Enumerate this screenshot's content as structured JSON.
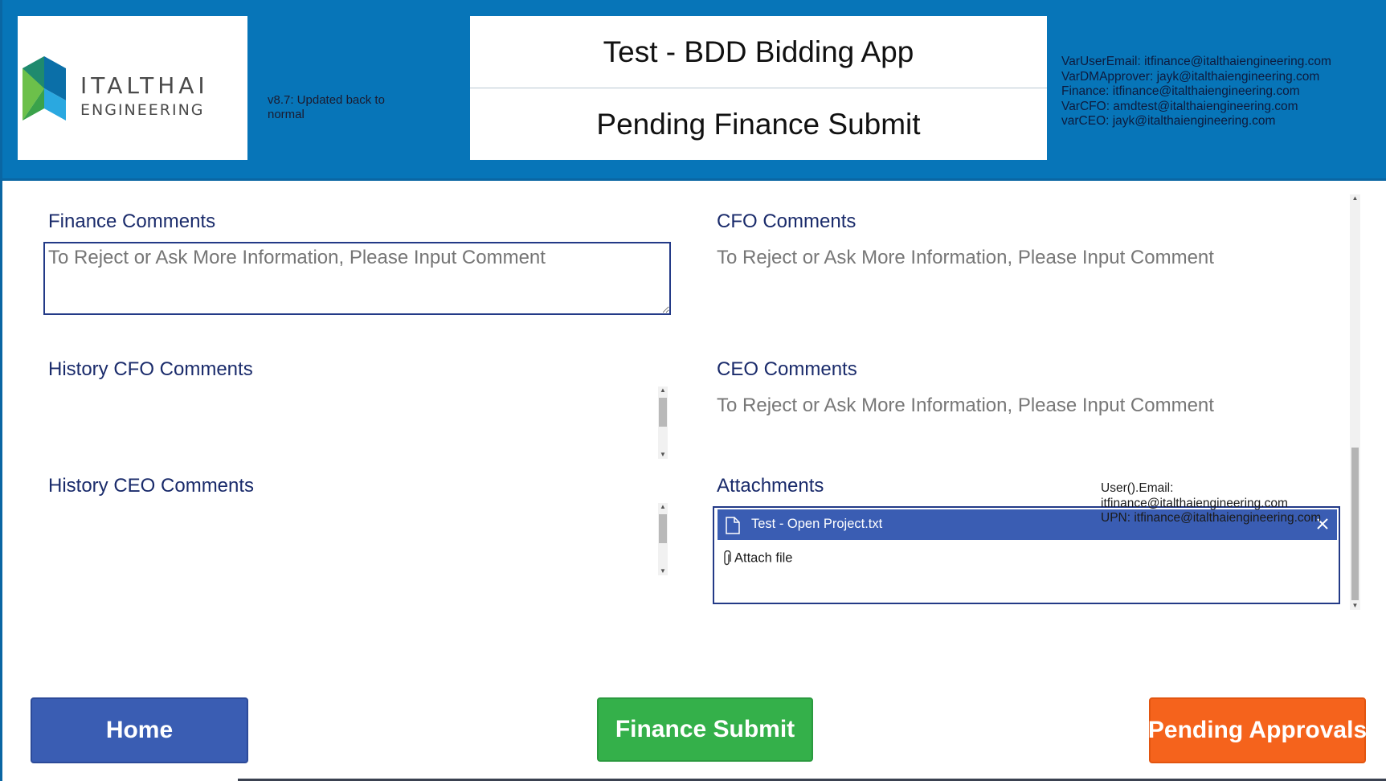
{
  "header": {
    "logo": {
      "word1": "ITALTHAI",
      "word2": "ENGINEERING"
    },
    "version_note": "v8.7: Updated back to normal",
    "app_title": "Test - BDD Bidding App",
    "screen_title": "Pending Finance Submit",
    "vars": [
      "VarUserEmail: itfinance@italthaiengineering.com",
      "VarDMApprover: jayk@italthaiengineering.com",
      "Finance: itfinance@italthaiengineering.com",
      "VarCFO: amdtest@italthaiengineering.com",
      "varCEO: jayk@italthaiengineering.com"
    ]
  },
  "form": {
    "finance_comments": {
      "label": "Finance Comments",
      "placeholder": "To Reject or Ask More Information, Please Input Comment",
      "value": ""
    },
    "cfo_comments": {
      "label": "CFO Comments",
      "placeholder": "To Reject or Ask More Information, Please Input Comment"
    },
    "history_cfo": {
      "label": "History CFO Comments"
    },
    "ceo_comments": {
      "label": "CEO Comments",
      "placeholder": "To Reject or Ask More Information, Please Input Comment"
    },
    "history_ceo": {
      "label": "History CEO Comments"
    },
    "attachments": {
      "label": "Attachments",
      "files": [
        {
          "name": "Test - Open Project.txt"
        }
      ],
      "attach_label": "Attach file"
    },
    "debug": {
      "line1": "User().Email:",
      "line2": "itfinance@italthaiengineering.com",
      "line3": "UPN: itfinance@italthaiengineering.com"
    }
  },
  "buttons": {
    "home": "Home",
    "finance_submit": "Finance Submit",
    "pending_approvals": "Pending Approvals"
  },
  "colors": {
    "header_bg": "#0775b8",
    "label": "#1a2b6b",
    "home_btn": "#3a5db3",
    "submit_btn": "#34b04a",
    "pending_btn": "#f5631c"
  }
}
